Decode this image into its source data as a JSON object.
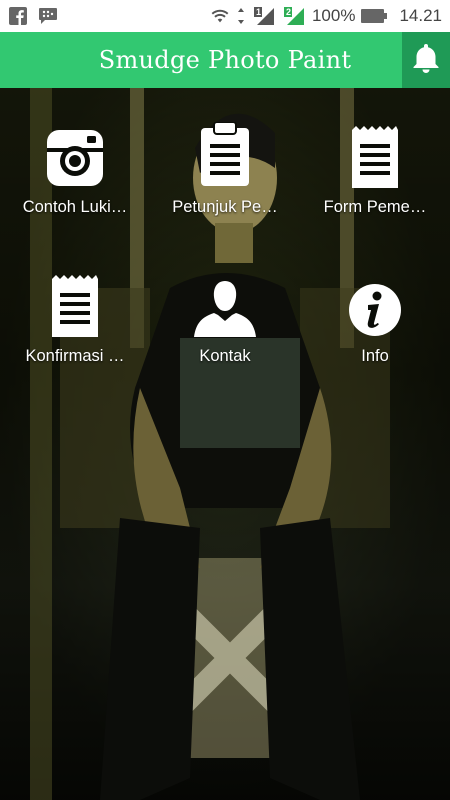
{
  "status_bar": {
    "battery_text": "100%",
    "time": "14.21",
    "left_icons": [
      "facebook-icon",
      "chat-icon"
    ],
    "right_icons": [
      "wifi-icon",
      "signal-1-icon",
      "signal-2-icon",
      "battery-icon"
    ],
    "sim1_label": "1",
    "sim2_label": "2"
  },
  "app_bar": {
    "title": "Smudge Photo Paint",
    "color": "#32c871",
    "bell_bg": "#1f9a56",
    "action_icon": "bell-icon"
  },
  "menu": {
    "items": [
      {
        "label": "Contoh Luki…",
        "icon": "camera-icon"
      },
      {
        "label": "Petunjuk Pe…",
        "icon": "clipboard-icon"
      },
      {
        "label": "Form Peme…",
        "icon": "notepad-icon"
      },
      {
        "label": "Konfirmasi …",
        "icon": "notepad-icon"
      },
      {
        "label": "Kontak",
        "icon": "person-icon"
      },
      {
        "label": "Info",
        "icon": "info-icon"
      }
    ]
  }
}
